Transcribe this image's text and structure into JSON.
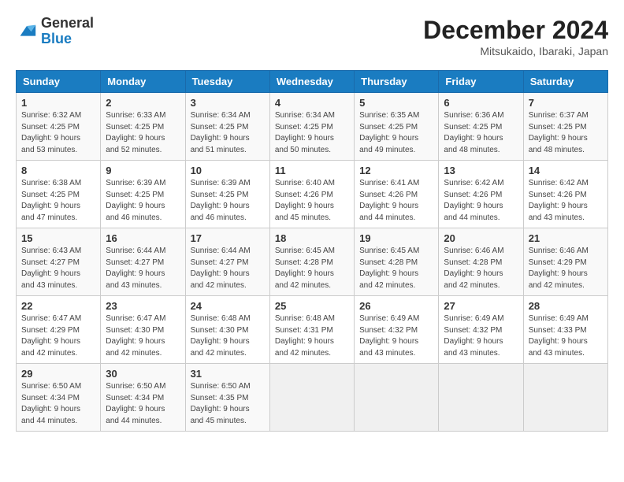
{
  "header": {
    "logo": {
      "general": "General",
      "blue": "Blue"
    },
    "title": "December 2024",
    "subtitle": "Mitsukaido, Ibaraki, Japan"
  },
  "weekdays": [
    "Sunday",
    "Monday",
    "Tuesday",
    "Wednesday",
    "Thursday",
    "Friday",
    "Saturday"
  ],
  "weeks": [
    [
      {
        "day": 1,
        "sunrise": "6:32 AM",
        "sunset": "4:25 PM",
        "daylight": "9 hours and 53 minutes."
      },
      {
        "day": 2,
        "sunrise": "6:33 AM",
        "sunset": "4:25 PM",
        "daylight": "9 hours and 52 minutes."
      },
      {
        "day": 3,
        "sunrise": "6:34 AM",
        "sunset": "4:25 PM",
        "daylight": "9 hours and 51 minutes."
      },
      {
        "day": 4,
        "sunrise": "6:34 AM",
        "sunset": "4:25 PM",
        "daylight": "9 hours and 50 minutes."
      },
      {
        "day": 5,
        "sunrise": "6:35 AM",
        "sunset": "4:25 PM",
        "daylight": "9 hours and 49 minutes."
      },
      {
        "day": 6,
        "sunrise": "6:36 AM",
        "sunset": "4:25 PM",
        "daylight": "9 hours and 48 minutes."
      },
      {
        "day": 7,
        "sunrise": "6:37 AM",
        "sunset": "4:25 PM",
        "daylight": "9 hours and 48 minutes."
      }
    ],
    [
      {
        "day": 8,
        "sunrise": "6:38 AM",
        "sunset": "4:25 PM",
        "daylight": "9 hours and 47 minutes."
      },
      {
        "day": 9,
        "sunrise": "6:39 AM",
        "sunset": "4:25 PM",
        "daylight": "9 hours and 46 minutes."
      },
      {
        "day": 10,
        "sunrise": "6:39 AM",
        "sunset": "4:25 PM",
        "daylight": "9 hours and 46 minutes."
      },
      {
        "day": 11,
        "sunrise": "6:40 AM",
        "sunset": "4:26 PM",
        "daylight": "9 hours and 45 minutes."
      },
      {
        "day": 12,
        "sunrise": "6:41 AM",
        "sunset": "4:26 PM",
        "daylight": "9 hours and 44 minutes."
      },
      {
        "day": 13,
        "sunrise": "6:42 AM",
        "sunset": "4:26 PM",
        "daylight": "9 hours and 44 minutes."
      },
      {
        "day": 14,
        "sunrise": "6:42 AM",
        "sunset": "4:26 PM",
        "daylight": "9 hours and 43 minutes."
      }
    ],
    [
      {
        "day": 15,
        "sunrise": "6:43 AM",
        "sunset": "4:27 PM",
        "daylight": "9 hours and 43 minutes."
      },
      {
        "day": 16,
        "sunrise": "6:44 AM",
        "sunset": "4:27 PM",
        "daylight": "9 hours and 43 minutes."
      },
      {
        "day": 17,
        "sunrise": "6:44 AM",
        "sunset": "4:27 PM",
        "daylight": "9 hours and 42 minutes."
      },
      {
        "day": 18,
        "sunrise": "6:45 AM",
        "sunset": "4:28 PM",
        "daylight": "9 hours and 42 minutes."
      },
      {
        "day": 19,
        "sunrise": "6:45 AM",
        "sunset": "4:28 PM",
        "daylight": "9 hours and 42 minutes."
      },
      {
        "day": 20,
        "sunrise": "6:46 AM",
        "sunset": "4:28 PM",
        "daylight": "9 hours and 42 minutes."
      },
      {
        "day": 21,
        "sunrise": "6:46 AM",
        "sunset": "4:29 PM",
        "daylight": "9 hours and 42 minutes."
      }
    ],
    [
      {
        "day": 22,
        "sunrise": "6:47 AM",
        "sunset": "4:29 PM",
        "daylight": "9 hours and 42 minutes."
      },
      {
        "day": 23,
        "sunrise": "6:47 AM",
        "sunset": "4:30 PM",
        "daylight": "9 hours and 42 minutes."
      },
      {
        "day": 24,
        "sunrise": "6:48 AM",
        "sunset": "4:30 PM",
        "daylight": "9 hours and 42 minutes."
      },
      {
        "day": 25,
        "sunrise": "6:48 AM",
        "sunset": "4:31 PM",
        "daylight": "9 hours and 42 minutes."
      },
      {
        "day": 26,
        "sunrise": "6:49 AM",
        "sunset": "4:32 PM",
        "daylight": "9 hours and 43 minutes."
      },
      {
        "day": 27,
        "sunrise": "6:49 AM",
        "sunset": "4:32 PM",
        "daylight": "9 hours and 43 minutes."
      },
      {
        "day": 28,
        "sunrise": "6:49 AM",
        "sunset": "4:33 PM",
        "daylight": "9 hours and 43 minutes."
      }
    ],
    [
      {
        "day": 29,
        "sunrise": "6:50 AM",
        "sunset": "4:34 PM",
        "daylight": "9 hours and 44 minutes."
      },
      {
        "day": 30,
        "sunrise": "6:50 AM",
        "sunset": "4:34 PM",
        "daylight": "9 hours and 44 minutes."
      },
      {
        "day": 31,
        "sunrise": "6:50 AM",
        "sunset": "4:35 PM",
        "daylight": "9 hours and 45 minutes."
      },
      null,
      null,
      null,
      null
    ]
  ]
}
